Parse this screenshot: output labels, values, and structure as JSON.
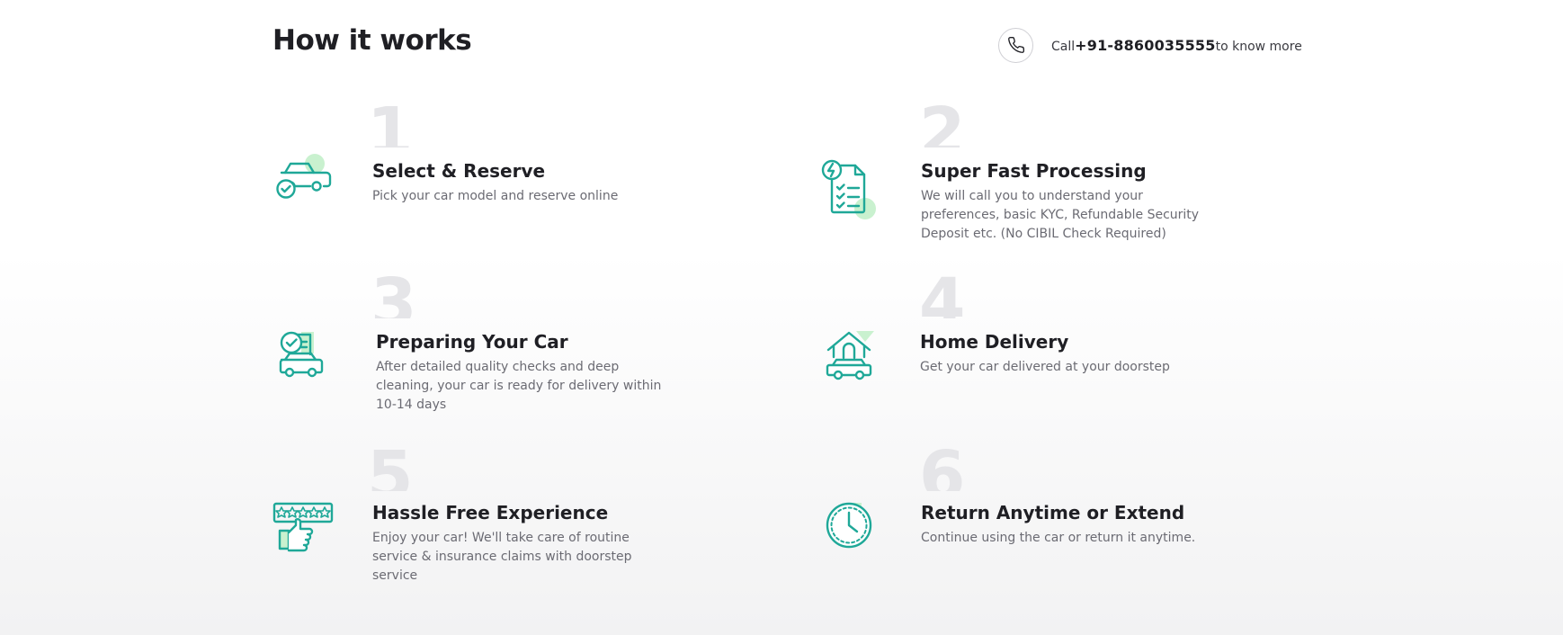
{
  "header": {
    "title": "How it works",
    "contact": {
      "prefix": "Call",
      "phone": "+91-8860035555",
      "suffix": "to know more",
      "icon": "phone-icon"
    }
  },
  "colors": {
    "accent": "#1fa898",
    "accent_light": "#c9f1cf",
    "number_gray": "#e5e5e8"
  },
  "steps": [
    {
      "number": "1",
      "title": "Select & Reserve",
      "description": "Pick your car model and reserve online",
      "icon": "car-check-icon"
    },
    {
      "number": "2",
      "title": "Super Fast Processing",
      "description": "We will call you to understand your preferences, basic KYC, Refundable Security Deposit etc. (No CIBIL Check Required)",
      "icon": "document-checklist-icon"
    },
    {
      "number": "3",
      "title": "Preparing Your Car",
      "description": "After detailed quality checks and deep cleaning, your car is ready for delivery within 10-14 days",
      "icon": "car-quality-check-icon"
    },
    {
      "number": "4",
      "title": "Home Delivery",
      "description": "Get your car delivered at your doorstep",
      "icon": "home-car-icon"
    },
    {
      "number": "5",
      "title": "Hassle Free Experience",
      "description": "Enjoy your car! We'll take care of routine service & insurance claims with doorstep service",
      "icon": "thumbs-up-rating-icon"
    },
    {
      "number": "6",
      "title": "Return Anytime or Extend",
      "description": "Continue using the car or return it anytime.",
      "icon": "clock-icon"
    }
  ]
}
